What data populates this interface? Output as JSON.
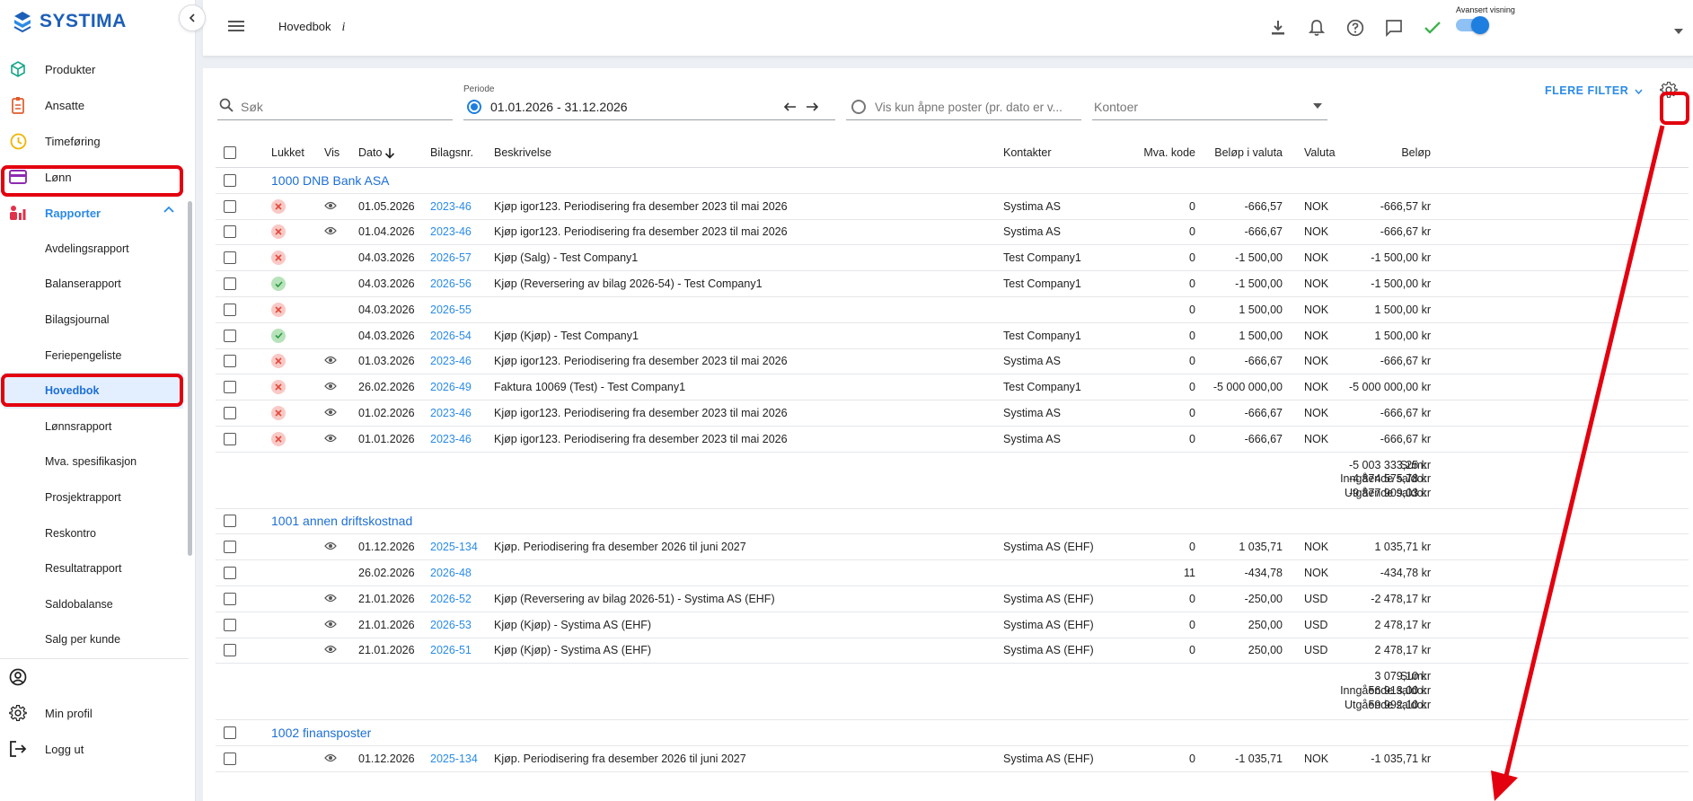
{
  "app": {
    "logo_text": "SYSTIMA",
    "brand_color": "#1d5fb8",
    "accent_color": "#2b8be6",
    "highlight_color": "#e3000f"
  },
  "sidebar": {
    "items": [
      {
        "label": "Produkter",
        "icon": "cube-icon"
      },
      {
        "label": "Ansatte",
        "icon": "badge-icon"
      },
      {
        "label": "Timeføring",
        "icon": "clock-icon"
      },
      {
        "label": "Lønn",
        "icon": "wallet-icon"
      },
      {
        "label": "Rapporter",
        "icon": "people-chart-icon"
      }
    ],
    "sub_items": [
      "Avdelingsrapport",
      "Balanserapport",
      "Bilagsjournal",
      "Feriepengeliste",
      "Hovedbok",
      "Lønnsrapport",
      "Mva. spesifikasjon",
      "Prosjektrapport",
      "Reskontro",
      "Resultatrapport",
      "Saldobalanse",
      "Salg per kunde"
    ],
    "bottom": [
      {
        "label": "",
        "icon": "account-circle-icon"
      },
      {
        "label": "Min profil",
        "icon": "gear-icon"
      },
      {
        "label": "Logg ut",
        "icon": "logout-icon"
      }
    ]
  },
  "topbar": {
    "page": "Hovedbok",
    "info": "i",
    "toggle_label": "Avansert visning"
  },
  "filters": {
    "search_placeholder": "Søk",
    "period_label": "Periode",
    "period_value": "01.01.2026 - 31.12.2026",
    "open_only_placeholder": "Vis kun åpne poster (pr. dato er v...",
    "accounts_placeholder": "Kontoer",
    "more_filters": "FLERE FILTER"
  },
  "table": {
    "headers": {
      "lukket": "Lukket",
      "vis": "Vis",
      "dato": "Dato",
      "bilag": "Bilagsnr.",
      "beskrivelse": "Beskrivelse",
      "kontakter": "Kontakter",
      "mva": "Mva. kode",
      "belop_valuta": "Beløp i valuta",
      "valuta": "Valuta",
      "belop": "Beløp"
    },
    "groups": [
      {
        "title": "1000 DNB Bank ASA",
        "rows": [
          {
            "status": "x",
            "vis": true,
            "dato": "01.05.2026",
            "bilag": "2023-46",
            "beskrivelse": "Kjøp igor123. Periodisering fra desember 2023 til mai 2026",
            "kontakt": "Systima AS",
            "mva": "0",
            "belop_valuta": "-666,57",
            "valuta": "NOK",
            "belop": "-666,57 kr"
          },
          {
            "status": "x",
            "vis": true,
            "dato": "01.04.2026",
            "bilag": "2023-46",
            "beskrivelse": "Kjøp igor123. Periodisering fra desember 2023 til mai 2026",
            "kontakt": "Systima AS",
            "mva": "0",
            "belop_valuta": "-666,67",
            "valuta": "NOK",
            "belop": "-666,67 kr"
          },
          {
            "status": "x",
            "vis": false,
            "dato": "04.03.2026",
            "bilag": "2026-57",
            "beskrivelse": "Kjøp (Salg) - Test Company1",
            "kontakt": "Test Company1",
            "mva": "0",
            "belop_valuta": "-1 500,00",
            "valuta": "NOK",
            "belop": "-1 500,00 kr"
          },
          {
            "status": "ok",
            "vis": false,
            "dato": "04.03.2026",
            "bilag": "2026-56",
            "beskrivelse": "Kjøp (Reversering av bilag 2026-54) - Test Company1",
            "kontakt": "Test Company1",
            "mva": "0",
            "belop_valuta": "-1 500,00",
            "valuta": "NOK",
            "belop": "-1 500,00 kr"
          },
          {
            "status": "x",
            "vis": false,
            "dato": "04.03.2026",
            "bilag": "2026-55",
            "beskrivelse": "",
            "kontakt": "",
            "mva": "0",
            "belop_valuta": "1 500,00",
            "valuta": "NOK",
            "belop": "1 500,00 kr"
          },
          {
            "status": "ok",
            "vis": false,
            "dato": "04.03.2026",
            "bilag": "2026-54",
            "beskrivelse": "Kjøp (Kjøp) - Test Company1",
            "kontakt": "Test Company1",
            "mva": "0",
            "belop_valuta": "1 500,00",
            "valuta": "NOK",
            "belop": "1 500,00 kr"
          },
          {
            "status": "x",
            "vis": true,
            "dato": "01.03.2026",
            "bilag": "2023-46",
            "beskrivelse": "Kjøp igor123. Periodisering fra desember 2023 til mai 2026",
            "kontakt": "Systima AS",
            "mva": "0",
            "belop_valuta": "-666,67",
            "valuta": "NOK",
            "belop": "-666,67 kr"
          },
          {
            "status": "x",
            "vis": true,
            "dato": "26.02.2026",
            "bilag": "2026-49",
            "beskrivelse": "Faktura 10069 (Test) - Test Company1",
            "kontakt": "Test Company1",
            "mva": "0",
            "belop_valuta": "-5 000 000,00",
            "valuta": "NOK",
            "belop": "-5 000 000,00 kr"
          },
          {
            "status": "x",
            "vis": true,
            "dato": "01.02.2026",
            "bilag": "2023-46",
            "beskrivelse": "Kjøp igor123. Periodisering fra desember 2023 til mai 2026",
            "kontakt": "Systima AS",
            "mva": "0",
            "belop_valuta": "-666,67",
            "valuta": "NOK",
            "belop": "-666,67 kr"
          },
          {
            "status": "x",
            "vis": true,
            "dato": "01.01.2026",
            "bilag": "2023-46",
            "beskrivelse": "Kjøp igor123. Periodisering fra desember 2023 til mai 2026",
            "kontakt": "Systima AS",
            "mva": "0",
            "belop_valuta": "-666,67",
            "valuta": "NOK",
            "belop": "-666,67 kr"
          }
        ],
        "summary": [
          {
            "label": "Sum:",
            "value": "-5 003 333,25 kr"
          },
          {
            "label": "Inngående saldo:",
            "value": "-4 874 575,78 kr"
          },
          {
            "label": "Utgående saldo:",
            "value": "-9 877 909,03 kr"
          }
        ]
      },
      {
        "title": "1001 annen driftskostnad",
        "rows": [
          {
            "status": "",
            "vis": true,
            "dato": "01.12.2026",
            "bilag": "2025-134",
            "beskrivelse": "Kjøp. Periodisering fra desember 2026 til juni 2027",
            "kontakt": "Systima AS (EHF)",
            "mva": "0",
            "belop_valuta": "1 035,71",
            "valuta": "NOK",
            "belop": "1 035,71 kr"
          },
          {
            "status": "",
            "vis": false,
            "dato": "26.02.2026",
            "bilag": "2026-48",
            "beskrivelse": "",
            "kontakt": "",
            "mva": "11",
            "belop_valuta": "-434,78",
            "valuta": "NOK",
            "belop": "-434,78 kr"
          },
          {
            "status": "",
            "vis": true,
            "dato": "21.01.2026",
            "bilag": "2026-52",
            "beskrivelse": "Kjøp (Reversering av bilag 2026-51) - Systima AS (EHF)",
            "kontakt": "Systima AS (EHF)",
            "mva": "0",
            "belop_valuta": "-250,00",
            "valuta": "USD",
            "belop": "-2 478,17 kr"
          },
          {
            "status": "",
            "vis": true,
            "dato": "21.01.2026",
            "bilag": "2026-53",
            "beskrivelse": "Kjøp (Kjøp) - Systima AS (EHF)",
            "kontakt": "Systima AS (EHF)",
            "mva": "0",
            "belop_valuta": "250,00",
            "valuta": "USD",
            "belop": "2 478,17 kr"
          },
          {
            "status": "",
            "vis": true,
            "dato": "21.01.2026",
            "bilag": "2026-51",
            "beskrivelse": "Kjøp (Kjøp) - Systima AS (EHF)",
            "kontakt": "Systima AS (EHF)",
            "mva": "0",
            "belop_valuta": "250,00",
            "valuta": "USD",
            "belop": "2 478,17 kr"
          }
        ],
        "summary": [
          {
            "label": "Sum:",
            "value": "3 079,10 kr"
          },
          {
            "label": "Inngående saldo:",
            "value": "56 913,00 kr"
          },
          {
            "label": "Utgående saldo:",
            "value": "59 992,10 kr"
          }
        ]
      },
      {
        "title": "1002 finansposter",
        "rows": [
          {
            "status": "",
            "vis": true,
            "dato": "01.12.2026",
            "bilag": "2025-134",
            "beskrivelse": "Kjøp. Periodisering fra desember 2026 til juni 2027",
            "kontakt": "Systima AS (EHF)",
            "mva": "0",
            "belop_valuta": "-1 035,71",
            "valuta": "NOK",
            "belop": "-1 035,71 kr"
          }
        ],
        "summary": []
      }
    ]
  }
}
